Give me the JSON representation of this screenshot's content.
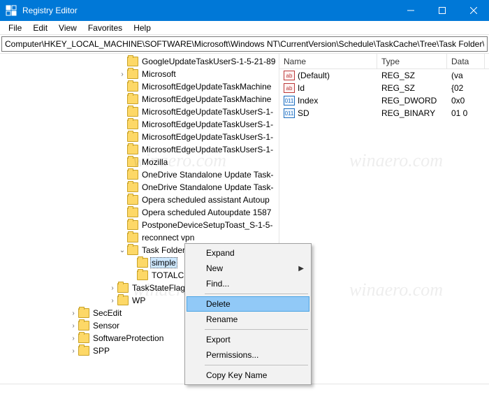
{
  "window": {
    "title": "Registry Editor"
  },
  "menus": {
    "file": "File",
    "edit": "Edit",
    "view": "View",
    "favorites": "Favorites",
    "help": "Help"
  },
  "address": "Computer\\HKEY_LOCAL_MACHINE\\SOFTWARE\\Microsoft\\Windows NT\\CurrentVersion\\Schedule\\TaskCache\\Tree\\Task Folder\\sim",
  "tree_items": [
    "GoogleUpdateTaskUserS-1-5-21-89",
    "Microsoft",
    "MicrosoftEdgeUpdateTaskMachine",
    "MicrosoftEdgeUpdateTaskMachine",
    "MicrosoftEdgeUpdateTaskUserS-1-",
    "MicrosoftEdgeUpdateTaskUserS-1-",
    "MicrosoftEdgeUpdateTaskUserS-1-",
    "MicrosoftEdgeUpdateTaskUserS-1-",
    "Mozilla",
    "OneDrive Standalone Update Task-",
    "OneDrive Standalone Update Task-",
    "Opera scheduled assistant Autoup",
    "Opera scheduled Autoupdate 1587",
    "PostponeDeviceSetupToast_S-1-5-",
    "reconnect vpn"
  ],
  "task_folder": {
    "label": "Task Folder",
    "children": {
      "simple": "simple",
      "totalcmd": "TOTALCMD"
    }
  },
  "after_items": [
    "TaskStateFlags",
    "WP"
  ],
  "deep_items": [
    "SecEdit",
    "Sensor",
    "SoftwareProtection",
    "SPP"
  ],
  "list": {
    "cols": {
      "name": "Name",
      "type": "Type",
      "data": "Data"
    },
    "rows": [
      {
        "name": "(Default)",
        "type": "REG_SZ",
        "data": "(va",
        "kind": "str"
      },
      {
        "name": "Id",
        "type": "REG_SZ",
        "data": "{02",
        "kind": "str"
      },
      {
        "name": "Index",
        "type": "REG_DWORD",
        "data": "0x0",
        "kind": "bin"
      },
      {
        "name": "SD",
        "type": "REG_BINARY",
        "data": "01 0",
        "kind": "bin"
      }
    ]
  },
  "ctx": {
    "expand": "Expand",
    "new": "New",
    "find": "Find...",
    "delete": "Delete",
    "rename": "Rename",
    "export": "Export",
    "permissions": "Permissions...",
    "copykey": "Copy Key Name"
  },
  "watermark": "winaero.com",
  "icons": {
    "ab": "ab",
    "bin": "011"
  }
}
